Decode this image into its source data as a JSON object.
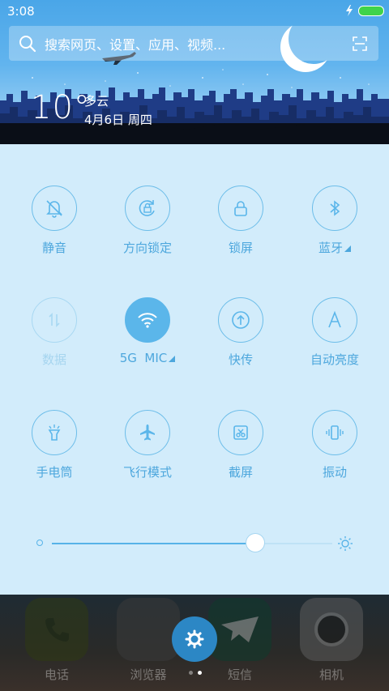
{
  "status": {
    "time": "3:08"
  },
  "search": {
    "placeholder": "搜索网页、设置、应用、视频..."
  },
  "weather": {
    "temperature": "10°",
    "condition": "多云",
    "date": "4月6日 周四"
  },
  "toggles": [
    {
      "label": "静音",
      "icon": "bell-off-icon",
      "active": false
    },
    {
      "label": "方向锁定",
      "icon": "rotation-lock-icon",
      "active": false
    },
    {
      "label": "锁屏",
      "icon": "lock-icon",
      "active": false
    },
    {
      "label": "蓝牙",
      "icon": "bluetooth-icon",
      "active": false,
      "expandable": true
    },
    {
      "label": "数据",
      "icon": "mobile-data-icon",
      "active": false,
      "disabled": true
    },
    {
      "label": "5G  MIC",
      "icon": "wifi-icon",
      "active": true,
      "expandable": true
    },
    {
      "label": "快传",
      "icon": "transfer-icon",
      "active": false
    },
    {
      "label": "自动亮度",
      "icon": "auto-brightness-icon",
      "active": false
    },
    {
      "label": "手电筒",
      "icon": "flashlight-icon",
      "active": false
    },
    {
      "label": "飞行模式",
      "icon": "airplane-icon",
      "active": false
    },
    {
      "label": "截屏",
      "icon": "screenshot-icon",
      "active": false
    },
    {
      "label": "振动",
      "icon": "vibrate-icon",
      "active": false
    }
  ],
  "brightness": {
    "level": 0.68
  },
  "dock": [
    {
      "label": "电话",
      "icon": "phone-icon"
    },
    {
      "label": "浏览器",
      "icon": "browser-icon"
    },
    {
      "label": "短信",
      "icon": "messages-icon"
    },
    {
      "label": "相机",
      "icon": "camera-icon"
    }
  ],
  "colors": {
    "accent": "#5bb6ea",
    "panel": "#d2ecfb"
  }
}
